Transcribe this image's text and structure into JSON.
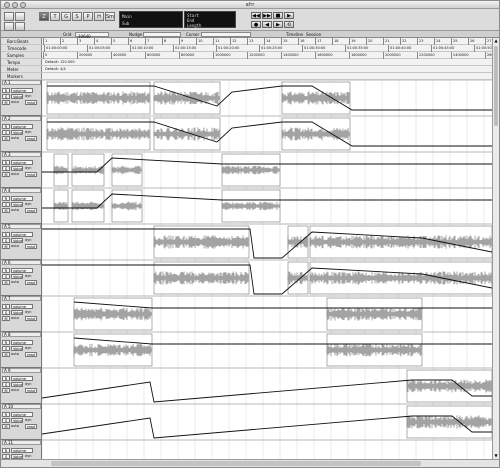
{
  "window": {
    "title": "afrr"
  },
  "toolbar": {
    "tools": [
      "Z",
      "T",
      "G",
      "S",
      "P",
      "H",
      "Sm"
    ],
    "counter_main": {
      "start_label": "Start",
      "end_label": "End",
      "length_label": "Length"
    },
    "counter_main_alt": {
      "a": "Main",
      "b": "Sub"
    },
    "transport": [
      "◀◀",
      "▶▶",
      "■",
      "▶",
      "●",
      "◀",
      "▶",
      "⟲"
    ]
  },
  "controls": {
    "grid_label": "Grid",
    "grid_value": "10640",
    "nudge_label": "Nudge",
    "cursor_label": "Cursor",
    "timeline_label": "Timeline",
    "session_label": "Session"
  },
  "rulers": {
    "labels": [
      "Bars:Beats",
      "Timecode",
      "Samples",
      "Tempo",
      "Meter",
      "Markers"
    ],
    "bars": [
      "1",
      "2",
      "3",
      "4",
      "5",
      "6",
      "7",
      "8",
      "9",
      "10",
      "11",
      "12",
      "13",
      "14",
      "15",
      "16",
      "17",
      "18",
      "19",
      "20",
      "21",
      "22",
      "23",
      "24",
      "25",
      "26",
      "27"
    ],
    "timecode": [
      "01:00:00:00",
      "01:00:05:00",
      "01:00:10:00",
      "01:00:15:00",
      "01:00:20:00",
      "01:00:25:00",
      "01:00:30:00",
      "01:00:35:00",
      "01:00:40:00",
      "01:00:45:00",
      "01:00:50:00"
    ],
    "samples": [
      "0",
      "200000",
      "400000",
      "600000",
      "800000",
      "1000000",
      "1200000",
      "1400000",
      "1600000",
      "1800000",
      "2000000",
      "2200000",
      "2400000",
      "2600000"
    ],
    "tempo_default": "Default: 120.000",
    "meter_default": "Default: 4/4"
  },
  "tracks": [
    {
      "name": "A 1",
      "view": "volume",
      "voice": "Voice",
      "dyn": "dyn",
      "auto": "auto",
      "read": "read"
    },
    {
      "name": "A 2",
      "view": "volume",
      "voice": "Voice",
      "dyn": "dyn",
      "auto": "auto",
      "read": "read"
    },
    {
      "name": "A 3",
      "view": "volume",
      "voice": "Voice",
      "dyn": "dyn",
      "auto": "auto",
      "read": "read"
    },
    {
      "name": "A 4",
      "view": "volume",
      "voice": "Voice",
      "dyn": "dyn",
      "auto": "auto",
      "read": "read"
    },
    {
      "name": "A 5",
      "view": "volume",
      "voice": "Voice",
      "dyn": "dyn",
      "auto": "auto",
      "read": "read"
    },
    {
      "name": "A 6",
      "view": "volume",
      "voice": "Voice",
      "dyn": "dyn",
      "auto": "auto",
      "read": "read"
    },
    {
      "name": "A 7",
      "view": "volume",
      "voice": "Voice",
      "dyn": "dyn",
      "auto": "auto",
      "read": "read"
    },
    {
      "name": "A 8",
      "view": "volume",
      "voice": "Voice",
      "dyn": "dyn",
      "auto": "auto",
      "read": "read"
    },
    {
      "name": "A 9",
      "view": "volume",
      "voice": "Voice",
      "dyn": "dyn",
      "auto": "auto",
      "read": "read"
    },
    {
      "name": "A 10",
      "view": "volume",
      "voice": "Voice",
      "dyn": "dyn",
      "auto": "auto",
      "read": "read"
    },
    {
      "name": "A 11",
      "view": "volume",
      "voice": "Voice",
      "dyn": "dyn",
      "auto": "auto",
      "read": "read"
    }
  ],
  "colors": {
    "waveform": "#8c8c8c",
    "automation": "#111111",
    "clip_border": "#777777",
    "grid": "#c8c8c8"
  }
}
